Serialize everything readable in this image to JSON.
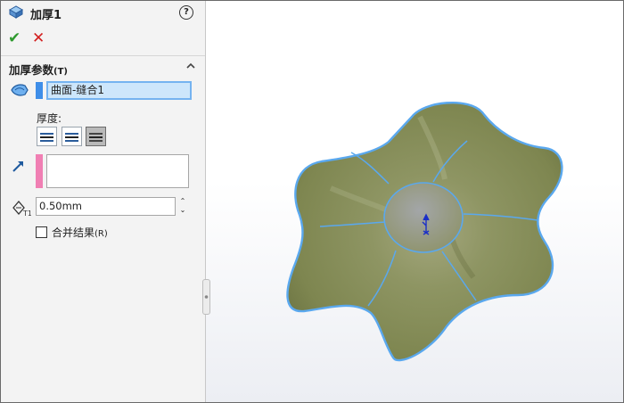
{
  "panel": {
    "title": "加厚1",
    "help_label": "?",
    "ok_symbol": "✔",
    "cancel_symbol": "✕",
    "section": {
      "title": "加厚参数",
      "mnemonic": "(T)"
    },
    "face_field_value": "曲面-缝合1",
    "thickness_label": "厚度:",
    "thickness_value": "0.50mm",
    "spinner_up": "⌃",
    "spinner_down": "⌄",
    "merge": {
      "label": "合并结果",
      "mnemonic": "(R)",
      "checked": false
    },
    "thickness_sides": [
      "side-1",
      "side-2",
      "both-sides"
    ],
    "active_side": "both-sides"
  },
  "viewport": {
    "model": "flower-shaped-surface",
    "colors": {
      "surface": "#8f9560",
      "edge": "#5aa8ee",
      "triad": "#1a2fc8"
    }
  },
  "colors": {
    "accent_blue": "#3f8ee8",
    "selection_fill": "#cde6fb",
    "direction_pink": "#f07fb3",
    "ok_green": "#2f9a2f",
    "cancel_red": "#d32020"
  }
}
